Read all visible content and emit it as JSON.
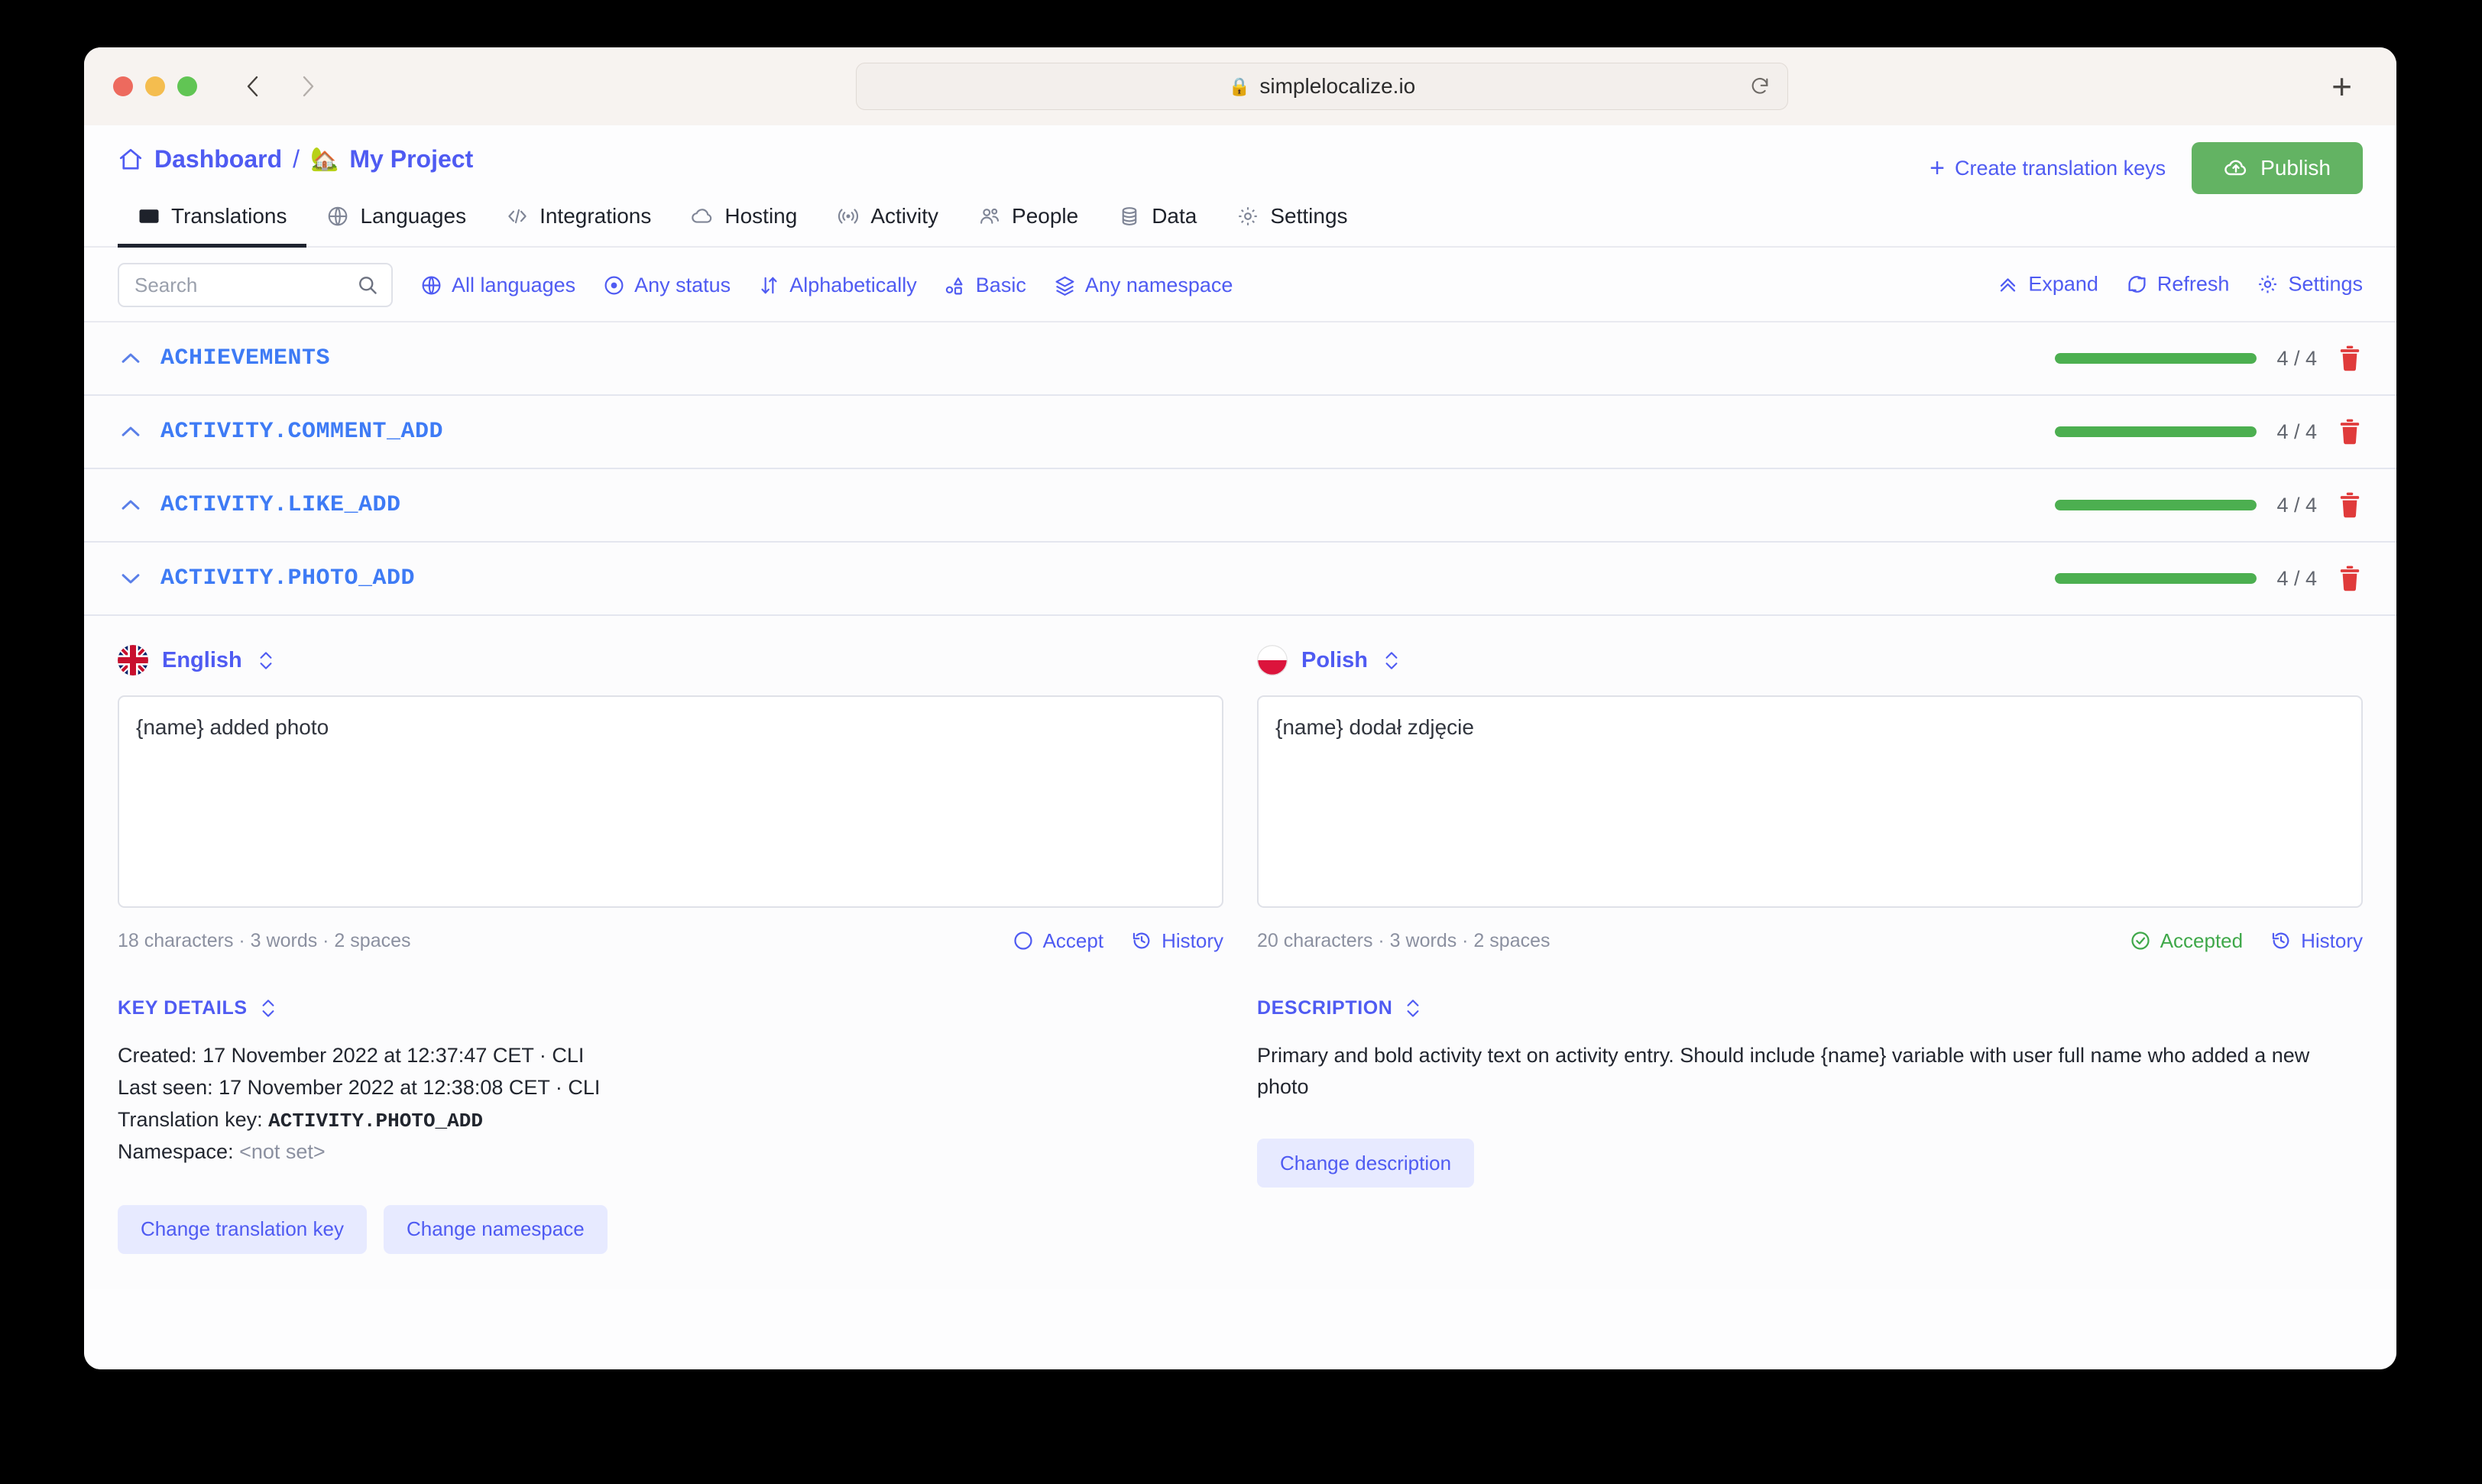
{
  "browser": {
    "url": "simplelocalize.io",
    "lock_icon": "lock-icon",
    "reload_icon": "reload-icon",
    "back_icon": "back-chevron-icon",
    "forward_icon": "forward-chevron-icon",
    "new_tab_label": "+"
  },
  "header": {
    "breadcrumb_home": "Dashboard",
    "breadcrumb_sep": "/",
    "project_emoji": "🏡",
    "project_name": "My Project",
    "create_keys_label": "Create translation keys",
    "create_keys_plus": "+",
    "publish_label": "Publish",
    "publish_color": "#63b363",
    "accent_color": "#4f5bf2"
  },
  "tabs": [
    {
      "label": "Translations",
      "icon": "translate-icon",
      "active": true
    },
    {
      "label": "Languages",
      "icon": "globe-icon",
      "active": false
    },
    {
      "label": "Integrations",
      "icon": "code-icon",
      "active": false
    },
    {
      "label": "Hosting",
      "icon": "cloud-icon",
      "active": false
    },
    {
      "label": "Activity",
      "icon": "broadcast-icon",
      "active": false
    },
    {
      "label": "People",
      "icon": "people-icon",
      "active": false
    },
    {
      "label": "Data",
      "icon": "database-icon",
      "active": false
    },
    {
      "label": "Settings",
      "icon": "gear-icon",
      "active": false
    }
  ],
  "toolbar": {
    "search_placeholder": "Search",
    "search_value": "",
    "filters": [
      {
        "label": "All languages",
        "icon": "globe-icon"
      },
      {
        "label": "Any status",
        "icon": "status-dot-icon"
      },
      {
        "label": "Alphabetically",
        "icon": "sort-icon"
      },
      {
        "label": "Basic",
        "icon": "view-basic-icon"
      },
      {
        "label": "Any namespace",
        "icon": "layers-icon"
      }
    ],
    "right_actions": [
      {
        "label": "Expand",
        "icon": "chevrons-up-icon"
      },
      {
        "label": "Refresh",
        "icon": "refresh-icon"
      },
      {
        "label": "Settings",
        "icon": "gear-icon"
      }
    ]
  },
  "keys": [
    {
      "name": "ACHIEVEMENTS",
      "expanded": false,
      "progress_percent": 100,
      "count": "4 / 4"
    },
    {
      "name": "ACTIVITY.COMMENT_ADD",
      "expanded": false,
      "progress_percent": 100,
      "count": "4 / 4"
    },
    {
      "name": "ACTIVITY.LIKE_ADD",
      "expanded": false,
      "progress_percent": 100,
      "count": "4 / 4"
    },
    {
      "name": "ACTIVITY.PHOTO_ADD",
      "expanded": true,
      "progress_percent": 100,
      "count": "4 / 4"
    }
  ],
  "detail": {
    "left": {
      "language": "English",
      "flag": "uk-flag-icon",
      "text": "{name} added photo",
      "stats": "18 characters · 3 words · 2 spaces",
      "accept_label": "Accept",
      "accepted": false,
      "history_label": "History"
    },
    "right": {
      "language": "Polish",
      "flag": "poland-flag-icon",
      "text": "{name} dodał zdjęcie",
      "stats": "20 characters · 3 words · 2 spaces",
      "accept_label": "Accepted",
      "accepted": true,
      "history_label": "History"
    },
    "key_details": {
      "title": "KEY DETAILS",
      "created_label": "Created:",
      "created_value": "17 November 2022 at 12:37:47 CET · CLI",
      "last_seen_label": "Last seen:",
      "last_seen_value": "17 November 2022 at 12:38:08 CET · CLI",
      "translation_key_label": "Translation key:",
      "translation_key_value": "ACTIVITY.PHOTO_ADD",
      "namespace_label": "Namespace:",
      "namespace_value": "<not set>",
      "change_key_button": "Change translation key",
      "change_namespace_button": "Change namespace"
    },
    "description": {
      "title": "DESCRIPTION",
      "text": "Primary and bold activity text on activity entry. Should include {name} variable with user full name who added a new photo",
      "change_description_button": "Change description"
    }
  }
}
